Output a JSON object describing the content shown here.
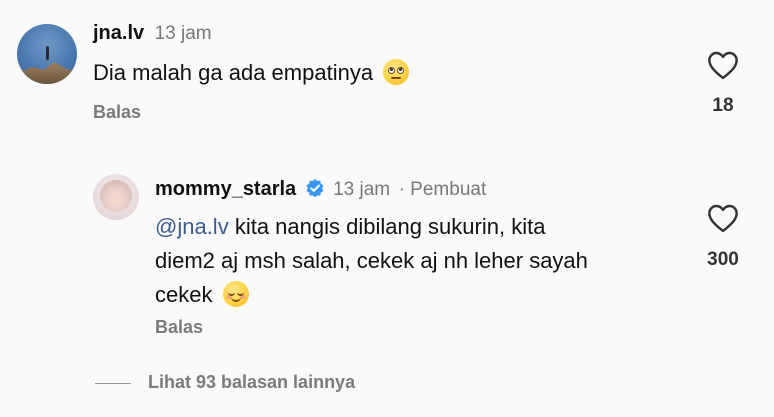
{
  "comments": [
    {
      "username": "jna.lv",
      "time": "13 jam",
      "text": "Dia malah ga ada empatinya",
      "emoji": "face-with-rolling-eyes",
      "reply_label": "Balas",
      "likes": "18"
    },
    {
      "username": "mommy_starla",
      "verified": true,
      "time": "13 jam",
      "author_tag": "· Pembuat",
      "mention": "@jna.lv",
      "text_line1": " kita nangis dibilang sukurin, kita",
      "text_line2": "diem2 aj msh salah, cekek aj nh leher sayah",
      "text_line3": "cekek",
      "emoji": "relieved-face",
      "reply_label": "Balas",
      "likes": "300"
    }
  ],
  "view_more_replies": "Lihat 93 balasan lainnya",
  "colors": {
    "mention": "#3b5b8f",
    "verified": "#3897f0",
    "background": "#fafafa"
  }
}
